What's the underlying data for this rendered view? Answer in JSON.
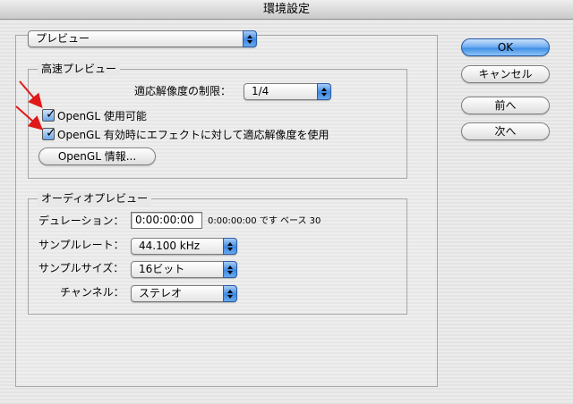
{
  "window": {
    "title": "環境設定"
  },
  "category": {
    "selected": "プレビュー"
  },
  "fast_preview": {
    "title": "高速プレビュー",
    "adaptive_label": "適応解像度の制限：",
    "adaptive_value": "1/4",
    "opengl_enabled": {
      "label": "OpenGL 使用可能",
      "checked": true
    },
    "opengl_adaptive": {
      "label": "OpenGL 有効時にエフェクトに対して適応解像度を使用",
      "checked": true
    },
    "opengl_info_button": "OpenGL 情報..."
  },
  "audio_preview": {
    "title": "オーディオプレビュー",
    "duration_label": "デュレーション：",
    "duration_value": "0:00:00:00",
    "duration_note": "0:00:00:00 です ベース 30",
    "sample_rate_label": "サンプルレート：",
    "sample_rate_value": "44.100 kHz",
    "sample_size_label": "サンプルサイズ：",
    "sample_size_value": "16ビット",
    "channels_label": "チャンネル：",
    "channels_value": "ステレオ"
  },
  "buttons": {
    "ok": "OK",
    "cancel": "キャンセル",
    "prev": "前へ",
    "next": "次へ"
  },
  "annotation_color": "#e01818"
}
